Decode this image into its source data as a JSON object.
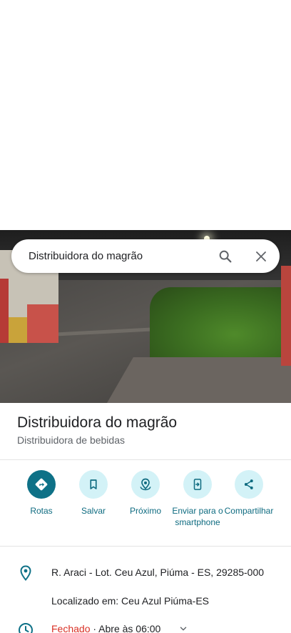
{
  "search": {
    "query": "Distribuidora do magrão"
  },
  "place": {
    "name": "Distribuidora do magrão",
    "category": "Distribuidora de bebidas"
  },
  "actions": [
    {
      "label": "Rotas",
      "icon": "directions-icon"
    },
    {
      "label": "Salvar",
      "icon": "bookmark-icon"
    },
    {
      "label": "Próximo",
      "icon": "nearby-icon"
    },
    {
      "label": "Enviar para o smartphone",
      "icon": "send-to-phone-icon"
    },
    {
      "label": "Compartilhar",
      "icon": "share-icon"
    }
  ],
  "info": {
    "address": "R. Araci - Lot. Ceu Azul, Piúma - ES, 29285-000",
    "located_in": "Localizado em: Ceu Azul Piúma-ES",
    "hours_status": "Fechado",
    "hours_next": " · Abre às 06:00"
  },
  "colors": {
    "accent": "#0e7187",
    "action_bg": "#d3f2f7",
    "action_text": "#0e6b80",
    "closed": "#d93025"
  }
}
